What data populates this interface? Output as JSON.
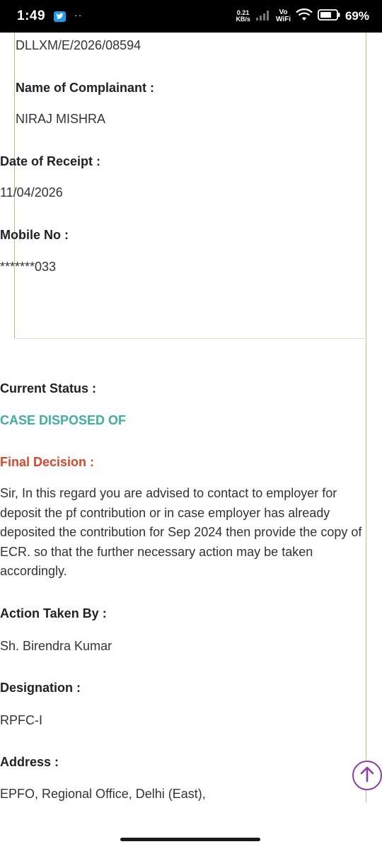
{
  "status_bar": {
    "time": "1:49",
    "dots": "··",
    "net_speed_value": "0.21",
    "net_speed_unit": "KB/s",
    "volte_top": "Vo",
    "volte_bottom": "WiFi",
    "battery_pct": "69%"
  },
  "complaint": {
    "registration_no": "DLLXM/E/2026/08594",
    "complainant_label": "Name of Complainant :",
    "complainant_value": "NIRAJ MISHRA",
    "receipt_label": "Date of Receipt :",
    "receipt_value": "11/04/2026",
    "mobile_label": "Mobile No :",
    "mobile_value": "*******033"
  },
  "status": {
    "current_label": "Current Status :",
    "current_value": "CASE DISPOSED OF",
    "decision_label": "Final Decision :",
    "decision_text": "Sir, In this regard you are advised to contact to employer for deposit the pf contribution or in case employer has already deposited the contribution for Sep 2024 then provide the copy of ECR. so that the further necessary action may be taken accordingly.",
    "action_label": "Action Taken By :",
    "action_value": "Sh. Birendra Kumar",
    "designation_label": "Designation :",
    "designation_value": "RPFC-I",
    "address_label": "Address :",
    "address_value": "EPFO, Regional Office, Delhi (East),"
  },
  "colors": {
    "status_green": "#3fae9c",
    "decision_red": "#d9472b",
    "scroll_purple": "#8e3ca8"
  },
  "icons": [
    "twitter-icon",
    "signal-icon",
    "wifi-icon",
    "battery-icon",
    "arrow-up-icon"
  ]
}
